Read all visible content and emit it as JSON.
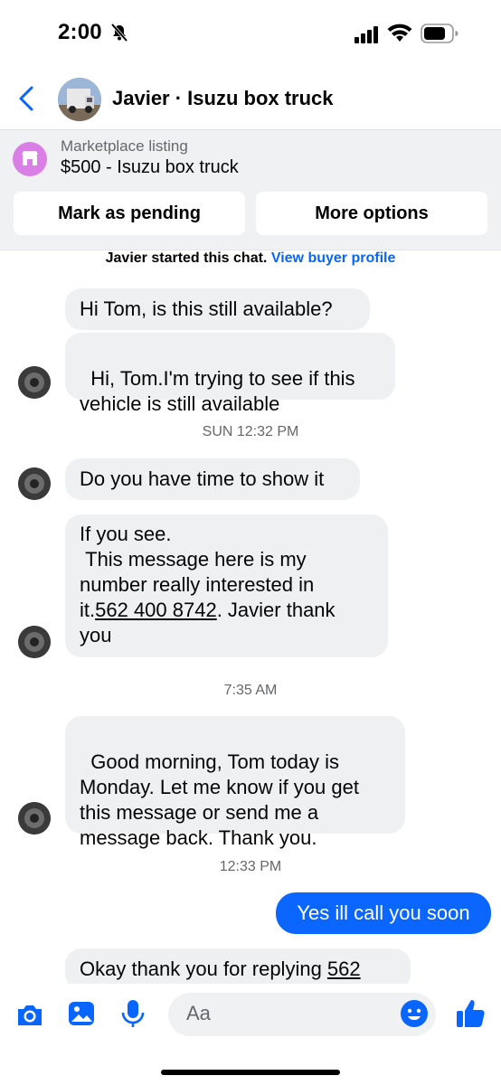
{
  "status": {
    "time": "2:00"
  },
  "header": {
    "title": "Javier · Isuzu box truck"
  },
  "listing": {
    "label": "Marketplace listing",
    "title": "$500 - Isuzu box truck",
    "buttons": [
      "Mark as pending",
      "More options"
    ]
  },
  "system": {
    "started_text": "Javier started this chat.",
    "link": "View buyer profile"
  },
  "messages": {
    "m1": "Hi Tom, is this still available?",
    "m2": "Hi, Tom.I'm trying to see if this\nvehicle is still available",
    "ts1": "SUN 12:32 PM",
    "m3": "Do you have time to show it",
    "m4_pre": "If you see.\n This message here is my\nnumber really interested in\nit.",
    "m4_phone": "562 400 8742",
    "m4_post": ". Javier thank\nyou",
    "ts2": "7:35 AM",
    "m5": "Good morning, Tom today is\nMonday. Let me know if you get\nthis message or send me a\nmessage back. Thank you.",
    "ts3": "12:33 PM",
    "out1": "Yes ill call you soon",
    "m6_pre": "Okay thank you for replying ",
    "m6_phone": "562"
  },
  "composer": {
    "placeholder": "Aa"
  },
  "icons": [
    "back-chevron-icon",
    "camera-icon",
    "photo-icon",
    "microphone-icon",
    "emoji-icon",
    "like-icon",
    "bell-slash-icon",
    "signal-icon",
    "wifi-icon",
    "battery-icon",
    "store-icon"
  ],
  "colors": {
    "accent": "#0a66ff",
    "link": "#0866ff",
    "store": "#d97fe6",
    "bubble": "#eff0f2"
  }
}
